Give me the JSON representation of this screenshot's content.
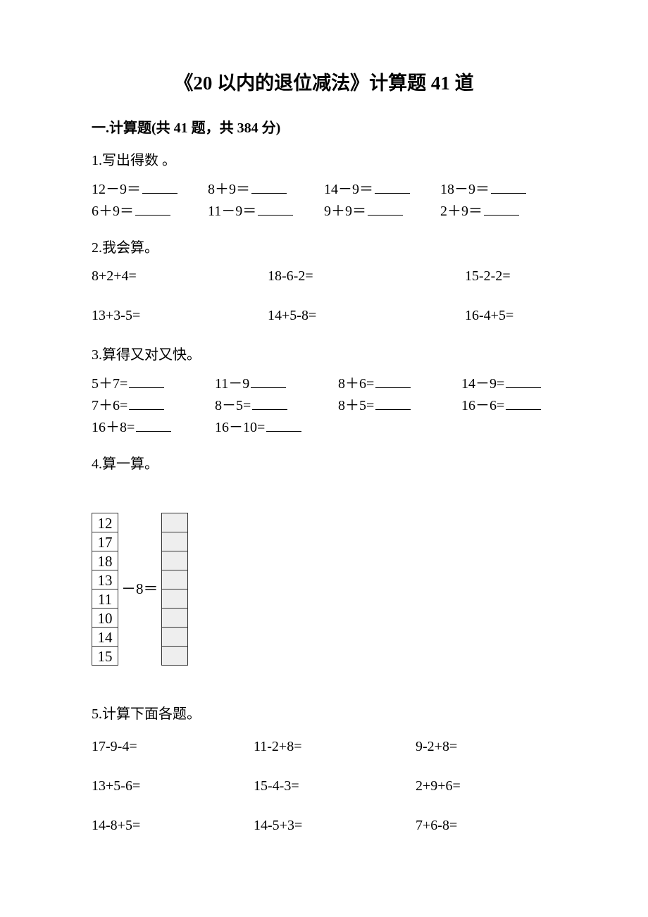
{
  "title": "《20 以内的退位减法》计算题 41 道",
  "section": "一.计算题(共 41 题，共 384 分)",
  "q1": {
    "heading": "1.写出得数 。",
    "rows": [
      [
        "12－9＝",
        "8＋9＝",
        "14－9＝",
        "18－9＝"
      ],
      [
        "6＋9＝",
        "11－9＝",
        "9＋9＝",
        "2＋9＝"
      ]
    ]
  },
  "q2": {
    "heading": "2.我会算。",
    "rows": [
      [
        "8+2+4=",
        "18-6-2=",
        "15-2-2="
      ],
      [
        "13+3-5=",
        "14+5-8=",
        "16-4+5="
      ]
    ]
  },
  "q3": {
    "heading": "3.算得又对又快。",
    "rows": [
      [
        "5＋7=",
        "11－9",
        "8＋6=",
        "14－9="
      ],
      [
        "7＋6=",
        "8－5=",
        "8＋5=",
        "16－6="
      ],
      [
        "16＋8=",
        "16－10=",
        "",
        ""
      ]
    ]
  },
  "q4": {
    "heading": "4.算一算。",
    "left": [
      "12",
      "17",
      "18",
      "13",
      "11",
      "10",
      "14",
      "15"
    ],
    "op": "－8＝"
  },
  "q5": {
    "heading": "5.计算下面各题。",
    "rows": [
      [
        "17-9-4=",
        "11-2+8=",
        "9-2+8="
      ],
      [
        "13+5-6=",
        "15-4-3=",
        "2+9+6="
      ],
      [
        "14-8+5=",
        "14-5+3=",
        "7+6-8="
      ]
    ]
  }
}
